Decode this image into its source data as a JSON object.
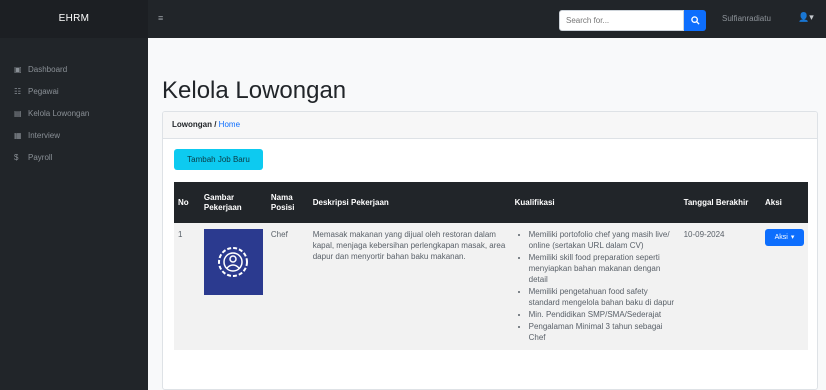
{
  "navbar": {
    "brand": "EHRM",
    "menu_toggle_icon": "bars-icon",
    "search_placeholder": "Search for...",
    "search_icon": "search-icon",
    "user_name": "Sulfianradiatu",
    "user_icon": "user-icon"
  },
  "sidebar": {
    "items": [
      {
        "label": "Dashboard",
        "icon": "dashboard-icon"
      },
      {
        "label": "Pegawai",
        "icon": "users-icon"
      },
      {
        "label": "Kelola Lowongan",
        "icon": "briefcase-icon"
      },
      {
        "label": "Interview",
        "icon": "calendar-icon"
      },
      {
        "label": "Payroll",
        "icon": "money-icon"
      }
    ]
  },
  "page": {
    "title": "Kelola Lowongan"
  },
  "breadcrumb": {
    "current": "Lowongan /",
    "home": "Home"
  },
  "add_button": "Tambah Job Baru",
  "table": {
    "headers": {
      "no": "No",
      "gambar": "Gambar Pekerjaan",
      "nama": "Nama Posisi",
      "deskripsi": "Deskripsi Pekerjaan",
      "kualifikasi": "Kualifikasi",
      "tanggal": "Tanggal Berakhir",
      "aksi": "Aksi"
    },
    "rows": [
      {
        "no": "1",
        "nama": "Chef",
        "deskripsi": "Memasak makanan yang dijual oleh restoran dalam kapal, menjaga kebersihan perlengkapan masak, area dapur dan menyortir bahan baku makanan.",
        "kualifikasi": [
          "Memiliki portofolio chef yang masih live/ online (sertakan URL dalam CV)",
          "Memiliki skill food preparation seperti menyiapkan bahan makanan dengan detail",
          "Memiliki pengetahuan food safety standard mengelola bahan baku di dapur",
          "Min. Pendidikan SMP/SMA/Sederajat",
          "Pengalaman Minimal 3 tahun sebagai Chef"
        ],
        "tanggal": "10-09-2024",
        "aksi": "Aksi"
      }
    ]
  },
  "colors": {
    "navbar_bg": "#212529",
    "primary": "#0d6efd",
    "info": "#0dcaf0",
    "image_bg": "#2b3a8f"
  }
}
